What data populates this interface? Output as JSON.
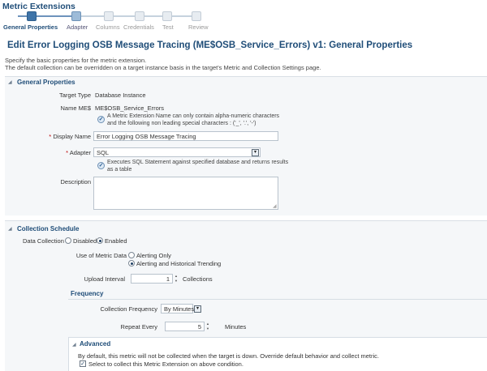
{
  "app": {
    "title": "Metric Extensions"
  },
  "train": {
    "steps": [
      {
        "label": "General Properties",
        "state": "active"
      },
      {
        "label": "Adapter",
        "state": "next"
      },
      {
        "label": "Columns",
        "state": "disabled"
      },
      {
        "label": "Credentials",
        "state": "disabled"
      },
      {
        "label": "Test",
        "state": "disabled"
      },
      {
        "label": "Review",
        "state": "disabled"
      }
    ]
  },
  "page": {
    "title": "Edit Error Logging OSB Message Tracing (ME$OSB_Service_Errors) v1: General Properties",
    "desc_line1": "Specify the basic properties for the metric extension.",
    "desc_line2": "The default collection can be overridden on a target instance basis in the target's Metric and Collection Settings page."
  },
  "general": {
    "title": "General Properties",
    "target_type_label": "Target Type",
    "target_type_value": "Database Instance",
    "name_label": "Name ME$",
    "name_value": "ME$OSB_Service_Errors",
    "name_note_line1": "A Metric Extension Name can only contain alpha-numeric characters",
    "name_note_line2": "and the following non leading special characters : ('_', '.', '-')",
    "display_name_req": "*",
    "display_name_label": "Display Name",
    "display_name_value": "Error Logging OSB Message Tracing",
    "adapter_req": "*",
    "adapter_label": "Adapter",
    "adapter_value": "SQL",
    "adapter_note_line1": "Executes SQL Statement against specified database and returns results",
    "adapter_note_line2": "as a table",
    "description_label": "Description",
    "description_value": ""
  },
  "collection": {
    "title": "Collection Schedule",
    "data_collection_label": "Data Collection",
    "disabled_label": "Disabled",
    "enabled_label": "Enabled",
    "data_collection_selected": "Enabled",
    "use_of_metric_label": "Use of Metric Data",
    "alerting_only_label": "Alerting Only",
    "alerting_hist_label": "Alerting and Historical Trending",
    "use_of_metric_selected": "Alerting and Historical Trending",
    "upload_interval_label": "Upload Interval",
    "upload_interval_value": "1",
    "upload_interval_unit": "Collections"
  },
  "frequency": {
    "title": "Frequency",
    "collection_frequency_label": "Collection Frequency",
    "collection_frequency_value": "By Minutes",
    "repeat_every_label": "Repeat Every",
    "repeat_every_value": "5",
    "repeat_every_unit": "Minutes"
  },
  "advanced": {
    "title": "Advanced",
    "desc": "By default, this metric will not be collected when the target is down. Override default behavior and collect metric.",
    "checkbox_label": "Select to collect this Metric Extension on above condition.",
    "checkbox_checked": true
  },
  "colors": {
    "title_blue": "#1f4d78",
    "active_step": "#3f74a8",
    "panel_bg": "#f5f7f9"
  }
}
